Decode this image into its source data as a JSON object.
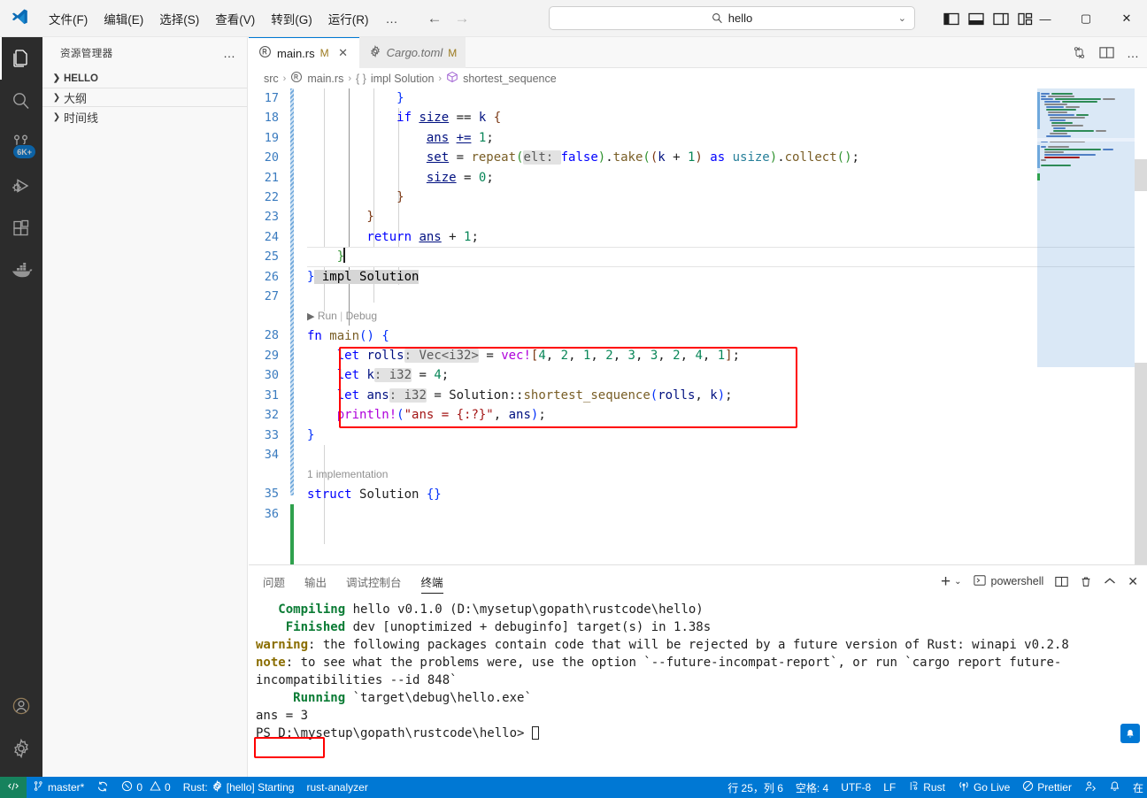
{
  "titlebar": {
    "logo": "vscode-logo",
    "menus": [
      {
        "label": "文件(F)",
        "accel": "F"
      },
      {
        "label": "编辑(E)",
        "accel": "E"
      },
      {
        "label": "选择(S)",
        "accel": "S"
      },
      {
        "label": "查看(V)",
        "accel": "V"
      },
      {
        "label": "转到(G)",
        "accel": "G"
      },
      {
        "label": "运行(R)",
        "accel": "R"
      }
    ],
    "more": "…",
    "back_arrow": "←",
    "forward_arrow": "→",
    "command_center": {
      "value": "hello",
      "icon": "search-icon",
      "chevron": "⌄"
    },
    "layout_icons": [
      "toggle-primary-sidebar-icon",
      "toggle-panel-icon",
      "toggle-secondary-sidebar-icon",
      "customize-layout-icon"
    ],
    "window": {
      "minimize": "—",
      "maximize": "▢",
      "close": "✕"
    }
  },
  "activitybar": {
    "items": [
      {
        "name": "explorer",
        "icon": "files-icon",
        "active": true,
        "badge": ""
      },
      {
        "name": "search",
        "icon": "search-icon",
        "active": false,
        "badge": ""
      },
      {
        "name": "source-control",
        "icon": "source-control-icon",
        "active": false,
        "badge": "6K+"
      },
      {
        "name": "run-debug",
        "icon": "run-and-debug-icon",
        "active": false,
        "badge": ""
      },
      {
        "name": "extensions",
        "icon": "extensions-icon",
        "active": false,
        "badge": ""
      },
      {
        "name": "docker",
        "icon": "docker-whale-icon",
        "active": false,
        "badge": ""
      }
    ],
    "bottom": [
      {
        "name": "accounts",
        "icon": "account-icon"
      },
      {
        "name": "settings",
        "icon": "gear-icon"
      }
    ]
  },
  "sidebar": {
    "title": "资源管理器",
    "more": "…",
    "sections": [
      {
        "label": "HELLO",
        "expanded": false,
        "bold": true
      },
      {
        "label": "大纲",
        "expanded": false,
        "bold": false
      },
      {
        "label": "时间线",
        "expanded": false,
        "bold": false
      }
    ]
  },
  "tabs": [
    {
      "label": "main.rs",
      "icon": "rust-file-icon",
      "modified": "M",
      "active": true,
      "close": "✕",
      "italic": false
    },
    {
      "label": "Cargo.toml",
      "icon": "gear-file-icon",
      "modified": "M",
      "active": false,
      "close": "",
      "italic": true
    }
  ],
  "tabbar_actions": [
    "split-editor-vertical-icon",
    "open-changes-icon",
    "more-actions-icon"
  ],
  "breadcrumb": [
    {
      "label": "src",
      "icon": ""
    },
    {
      "label": "main.rs",
      "icon": "rust-file-icon"
    },
    {
      "label": "impl Solution",
      "icon": "braces-icon"
    },
    {
      "label": "shortest_sequence",
      "icon": "method-icon"
    }
  ],
  "breadcrumb_separator": "›",
  "editor": {
    "first_line": 17,
    "line_numbers": [
      17,
      18,
      19,
      20,
      21,
      22,
      23,
      24,
      25,
      26,
      27,
      28,
      29,
      30,
      31,
      32,
      33,
      34,
      35,
      36
    ],
    "codelens_main": {
      "run": "Run",
      "sep": "|",
      "debug": "Debug"
    },
    "codelens_struct": "1 implementation",
    "cursor_line": 25
  },
  "code_text": {
    "l17": "            }",
    "l18": "            if size == k {",
    "l19": "                ans += 1;",
    "l20": "                set = repeat(elt: false).take((k + 1) as usize).collect();",
    "l21": "                size = 0;",
    "l22": "            }",
    "l23": "        }",
    "l24": "        return ans + 1;",
    "l25": "    }",
    "l26": "} impl Solution",
    "l27": "",
    "l28": "fn main() {",
    "l29": "    let rolls: Vec<i32> = vec![4, 2, 1, 2, 3, 3, 2, 4, 1];",
    "l30": "    let k: i32 = 4;",
    "l31": "    let ans: i32 = Solution::shortest_sequence(rolls, k);",
    "l32": "    println!(\"ans = {:?}\", ans);",
    "l33": "}",
    "l34": "",
    "l35": "struct Solution {}",
    "l36": ""
  },
  "panel": {
    "tabs": [
      {
        "label": "问题",
        "active": false
      },
      {
        "label": "输出",
        "active": false
      },
      {
        "label": "调试控制台",
        "active": false
      },
      {
        "label": "终端",
        "active": true
      }
    ],
    "actions": {
      "new_terminal": "+",
      "new_terminal_chevron": "⌄",
      "terminal_name": "powershell",
      "terminal_icon": "terminal-powershell-icon",
      "split": "split-terminal-icon",
      "kill": "trash-icon",
      "maximize": "chevron-up-icon",
      "close": "✕"
    }
  },
  "terminal_output": {
    "line1_label": "Compiling",
    "line1_text": " hello v0.1.0 (D:\\mysetup\\gopath\\rustcode\\hello)",
    "line2_label": "Finished",
    "line2_text": " dev [unoptimized + debuginfo] target(s) in 1.38s",
    "line3_label": "warning",
    "line3_text": ": the following packages contain code that will be rejected by a future version of Rust: winapi v0.2.8",
    "line4_label": "note",
    "line4_text": ": to see what the problems were, use the option `--future-incompat-report`, or run `cargo report future-incompatibilities --id 848`",
    "line5_label": "Running",
    "line5_text": " `target\\debug\\hello.exe`",
    "line6_text": "ans = 3",
    "line7_text": "PS D:\\mysetup\\gopath\\rustcode\\hello> "
  },
  "statusbar": {
    "left": [
      {
        "name": "remote",
        "icon": "",
        "label": ""
      },
      {
        "name": "branch",
        "icon": "source-control-icon",
        "label": "master*"
      },
      {
        "name": "sync",
        "icon": "sync-icon",
        "label": ""
      },
      {
        "name": "problems",
        "icon": "error-warning-icon",
        "label": "0  0",
        "errors": "0",
        "warnings": "0"
      },
      {
        "name": "rust-status",
        "icon": "gear-icon",
        "label": "Rust:",
        "label2": "[hello] Starting"
      },
      {
        "name": "rust-analyzer",
        "icon": "",
        "label": "rust-analyzer"
      }
    ],
    "right": [
      {
        "name": "cursor-position",
        "label": "行 25，列 6"
      },
      {
        "name": "indentation",
        "label": "空格: 4"
      },
      {
        "name": "encoding",
        "label": "UTF-8"
      },
      {
        "name": "eol",
        "label": "LF"
      },
      {
        "name": "language-mode",
        "icon": "rust-lang-icon",
        "label": "Rust"
      },
      {
        "name": "go-live",
        "icon": "broadcast-icon",
        "label": "Go Live"
      },
      {
        "name": "prettier",
        "icon": "prettier-icon",
        "label": "Prettier"
      },
      {
        "name": "feedback",
        "icon": "feedback-icon",
        "label": ""
      },
      {
        "name": "notifications",
        "icon": "bell-icon",
        "label": ""
      }
    ],
    "ime_hint": "在"
  },
  "colors": {
    "accent": "#0078d4",
    "statusbar_bg": "#0078d4",
    "activitybar_bg": "#2c2c2c",
    "sidebar_bg": "#f8f8f8",
    "annotation_red": "#ff0000",
    "keyword_blue": "#0000ff",
    "type_teal": "#267f99",
    "number_green": "#098658",
    "string_red": "#a31515",
    "macro_purple": "#af00db"
  }
}
